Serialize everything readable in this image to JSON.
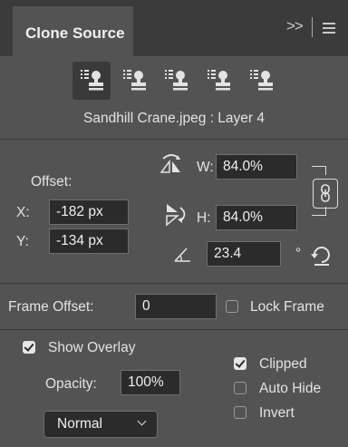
{
  "panel": {
    "tab_label": "Clone Source",
    "collapse_glyph": ">>",
    "menu_icon": "hamburger-menu-icon"
  },
  "sources": {
    "icon": "clone-stamp-icon",
    "count": 5,
    "active_index": 0,
    "info": "Sandhill Crane.jpeg : Layer 4"
  },
  "offset": {
    "label": "Offset:",
    "x_label": "X:",
    "x_value": "-182 px",
    "y_label": "Y:",
    "y_value": "-134 px"
  },
  "transform": {
    "w_label": "W:",
    "w_value": "84.0%",
    "h_label": "H:",
    "h_value": "84.0%",
    "angle_value": "23.4",
    "degree_symbol": "°",
    "flip_h_icon": "flip-horizontal-icon",
    "flip_v_icon": "flip-vertical-icon",
    "angle_icon": "angle-icon",
    "reset_icon": "reset-transform-icon",
    "link_icon": "link-icon"
  },
  "frame": {
    "label": "Frame Offset:",
    "value": "0",
    "lock_label": "Lock Frame",
    "lock_checked": false
  },
  "overlay": {
    "show_label": "Show Overlay",
    "show_checked": true,
    "opacity_label": "Opacity:",
    "opacity_value": "100%",
    "blend_mode": "Normal",
    "clipped_label": "Clipped",
    "clipped_checked": true,
    "autohide_label": "Auto Hide",
    "autohide_checked": false,
    "invert_label": "Invert",
    "invert_checked": false
  },
  "colors": {
    "panel_bg": "#535353",
    "tabbar_bg": "#3b3b3b",
    "field_bg": "#2b2b2b",
    "text": "#e3e3e3"
  }
}
